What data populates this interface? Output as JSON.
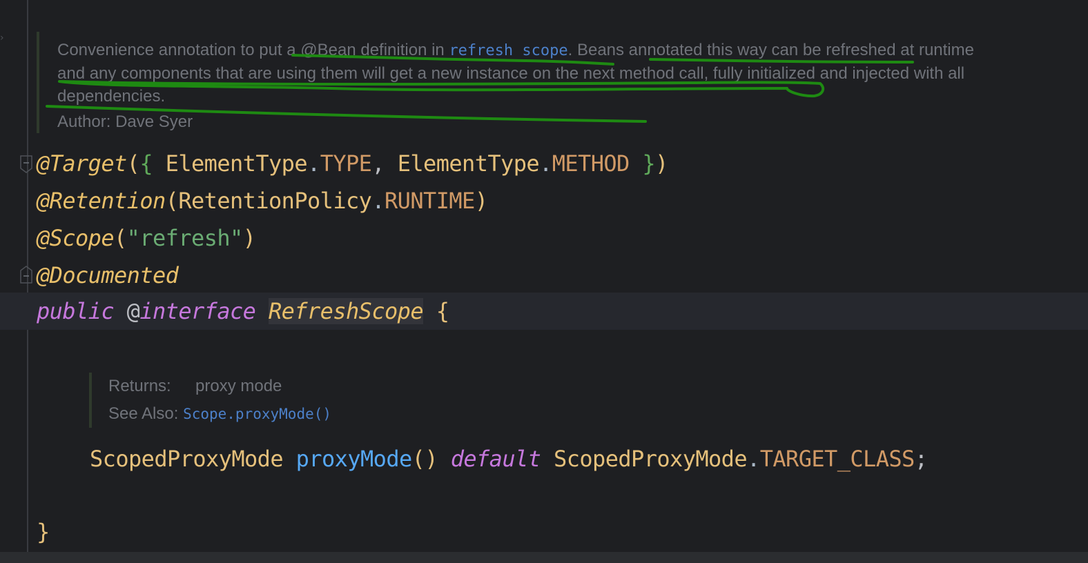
{
  "doc": {
    "part1": "Convenience annotation to put a @Bean definition in ",
    "link": "refresh scope",
    "part2": ". Beans annotated this way can be refreshed at runtime and any components that are using them will get a new instance on the next method call, fully initialized and injected with all dependencies.",
    "author_label": "Author:",
    "author_name": "Dave Syer"
  },
  "code": {
    "l1_ann": "@Target",
    "l1_open": "(",
    "l1_brace_open": "{",
    "l1_type1": " ElementType",
    "l1_dot1": ".",
    "l1_const1": "TYPE",
    "l1_comma": ", ",
    "l1_type2": "ElementType",
    "l1_dot2": ".",
    "l1_const2": "METHOD",
    "l1_brace_close": " }",
    "l1_close": ")",
    "l2_ann": "@Retention",
    "l2_open": "(",
    "l2_type": "RetentionPolicy",
    "l2_dot": ".",
    "l2_const": "RUNTIME",
    "l2_close": ")",
    "l3_ann": "@Scope",
    "l3_open": "(",
    "l3_str": "\"refresh\"",
    "l3_close": ")",
    "l4_ann": "@Documented",
    "l5_kw1": "public",
    "l5_at": "@",
    "l5_kw2": "interface",
    "l5_class": "RefreshScope",
    "l5_brace": "{",
    "l6_type": "ScopedProxyMode",
    "l6_method": "proxyMode",
    "l6_parens": "()",
    "l6_kw": "default",
    "l6_type2": "ScopedProxyMode",
    "l6_dot": ".",
    "l6_const": "TARGET_CLASS",
    "l6_semi": ";",
    "l7_brace": "}"
  },
  "method_doc": {
    "returns_label": "Returns:",
    "returns_value": "proxy mode",
    "see_also_label": "See Also:",
    "see_also_link": "Scope.proxyMode()"
  },
  "colors": {
    "background": "#1e1f22",
    "annotation": "#e8bf6a",
    "keyword": "#c678dd",
    "string": "#6aab73",
    "method": "#56a8f5",
    "hand_drawn_underline": "#1e8a12"
  }
}
